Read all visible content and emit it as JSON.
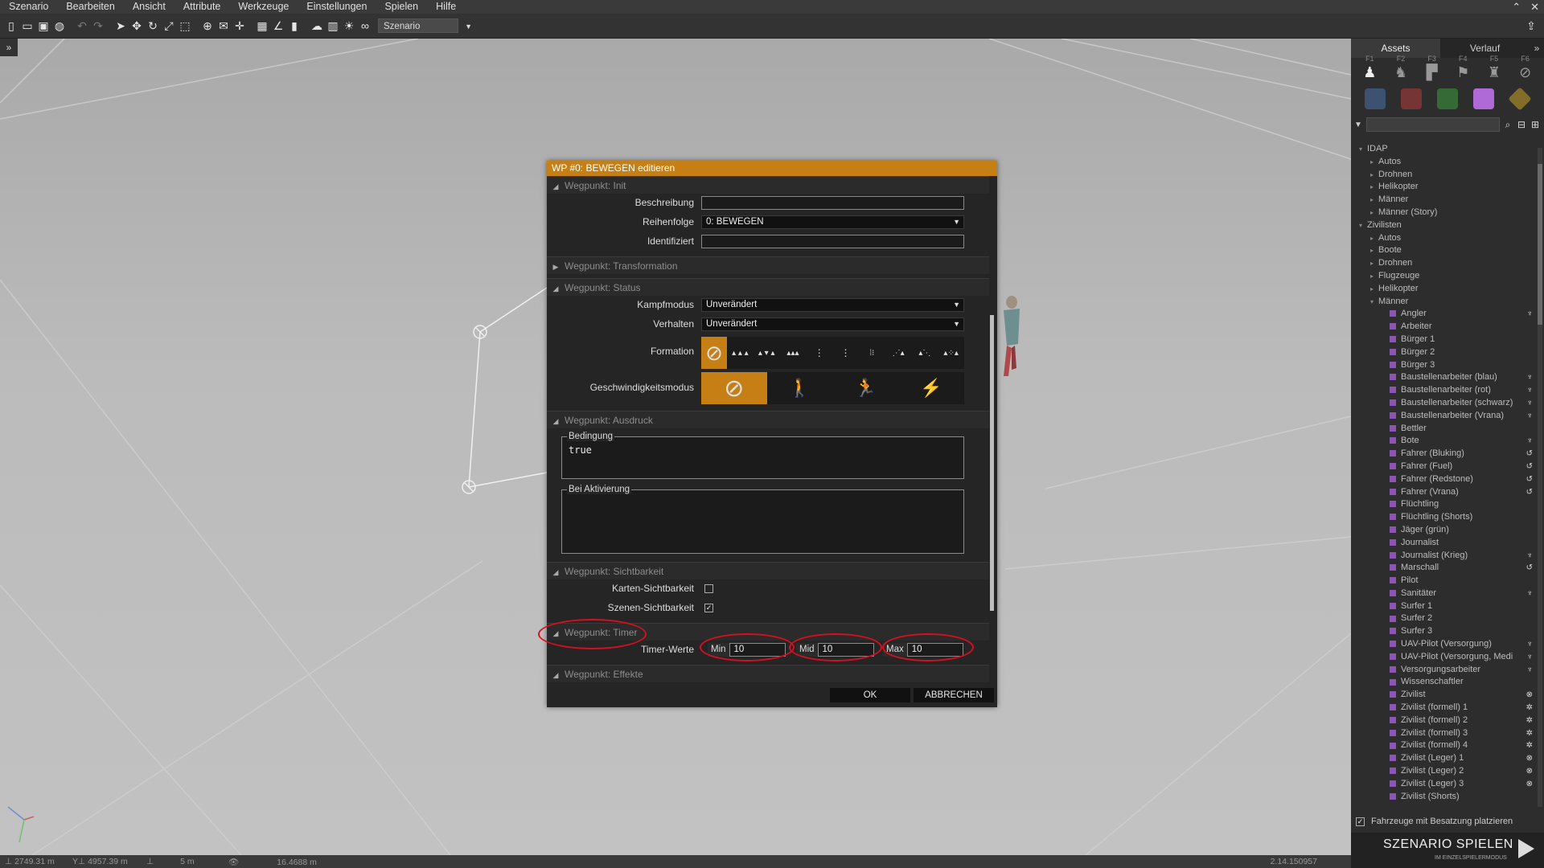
{
  "menu": {
    "items": [
      "Szenario",
      "Bearbeiten",
      "Ansicht",
      "Attribute",
      "Werkzeuge",
      "Einstellungen",
      "Spielen",
      "Hilfe"
    ]
  },
  "toolbar": {
    "scenario_select": "Szenario"
  },
  "status_bar": {
    "x": "2749.31 m",
    "y": "4957.39 m",
    "z": "5 m",
    "view": "16.4688 m",
    "right_value": "2.14.150957"
  },
  "dialog": {
    "title": "WP #0: BEWEGEN editieren",
    "sections": {
      "init": "Wegpunkt: Init",
      "transformation": "Wegpunkt: Transformation",
      "status": "Wegpunkt: Status",
      "ausdruck": "Wegpunkt: Ausdruck",
      "sichtbarkeit": "Wegpunkt: Sichtbarkeit",
      "timer": "Wegpunkt: Timer",
      "effekte": "Wegpunkt: Effekte"
    },
    "init": {
      "beschreibung_label": "Beschreibung",
      "beschreibung_value": "",
      "reihenfolge_label": "Reihenfolge",
      "reihenfolge_value": "0: BEWEGEN",
      "identifiziert_label": "Identifiziert",
      "identifiziert_value": ""
    },
    "status": {
      "kampfmodus_label": "Kampfmodus",
      "kampfmodus_value": "Unverändert",
      "verhalten_label": "Verhalten",
      "verhalten_value": "Unverändert",
      "formation_label": "Formation",
      "geschwindigkeit_label": "Geschwindigkeitsmodus"
    },
    "ausdruck": {
      "bedingung_label": "Bedingung",
      "bedingung_value": "true",
      "aktivierung_label": "Bei Aktivierung",
      "aktivierung_value": ""
    },
    "sichtbarkeit": {
      "karten_label": "Karten-Sichtbarkeit",
      "karten_checked": false,
      "szenen_label": "Szenen-Sichtbarkeit",
      "szenen_checked": true
    },
    "timer": {
      "label": "Timer-Werte",
      "min_label": "Min",
      "min_value": "10",
      "mid_label": "Mid",
      "mid_value": "10",
      "max_label": "Max",
      "max_value": "10"
    },
    "buttons": {
      "ok": "OK",
      "cancel": "ABBRECHEN"
    }
  },
  "right_panel": {
    "tabs": [
      "Assets",
      "Verlauf"
    ],
    "function_keys": [
      "F1",
      "F2",
      "F3",
      "F4",
      "F5",
      "F6"
    ],
    "swatch_colors": [
      "#4a6fa8",
      "#b33a3a",
      "#3c9a3c",
      "#b06ad8",
      "#c9a227"
    ],
    "tree": [
      {
        "label": "IDAP",
        "level": 0,
        "toggle": "▾"
      },
      {
        "label": "Autos",
        "level": 1,
        "toggle": "▸"
      },
      {
        "label": "Drohnen",
        "level": 1,
        "toggle": "▸"
      },
      {
        "label": "Helikopter",
        "level": 1,
        "toggle": "▸"
      },
      {
        "label": "Männer",
        "level": 1,
        "toggle": "▸"
      },
      {
        "label": "Männer (Story)",
        "level": 1,
        "toggle": "▸"
      },
      {
        "label": "Zivilisten",
        "level": 0,
        "toggle": "▾"
      },
      {
        "label": "Autos",
        "level": 1,
        "toggle": "▸"
      },
      {
        "label": "Boote",
        "level": 1,
        "toggle": "▸"
      },
      {
        "label": "Drohnen",
        "level": 1,
        "toggle": "▸"
      },
      {
        "label": "Flugzeuge",
        "level": 1,
        "toggle": "▸"
      },
      {
        "label": "Helikopter",
        "level": 1,
        "toggle": "▸"
      },
      {
        "label": "Männer",
        "level": 1,
        "toggle": "▾"
      },
      {
        "label": "Angler",
        "level": 2,
        "right_icon": "♆"
      },
      {
        "label": "Arbeiter",
        "level": 2
      },
      {
        "label": "Bürger 1",
        "level": 2
      },
      {
        "label": "Bürger 2",
        "level": 2
      },
      {
        "label": "Bürger 3",
        "level": 2
      },
      {
        "label": "Baustellenarbeiter (blau)",
        "level": 2,
        "right_icon": "♆"
      },
      {
        "label": "Baustellenarbeiter (rot)",
        "level": 2,
        "right_icon": "♆"
      },
      {
        "label": "Baustellenarbeiter (schwarz)",
        "level": 2,
        "right_icon": "♆"
      },
      {
        "label": "Baustellenarbeiter (Vrana)",
        "level": 2,
        "right_icon": "♆"
      },
      {
        "label": "Bettler",
        "level": 2
      },
      {
        "label": "Bote",
        "level": 2,
        "right_icon": "♆"
      },
      {
        "label": "Fahrer (Bluking)",
        "level": 2,
        "right_icon": "↺"
      },
      {
        "label": "Fahrer (Fuel)",
        "level": 2,
        "right_icon": "↺"
      },
      {
        "label": "Fahrer (Redstone)",
        "level": 2,
        "right_icon": "↺"
      },
      {
        "label": "Fahrer (Vrana)",
        "level": 2,
        "right_icon": "↺"
      },
      {
        "label": "Flüchtling",
        "level": 2
      },
      {
        "label": "Flüchtling (Shorts)",
        "level": 2
      },
      {
        "label": "Jäger (grün)",
        "level": 2
      },
      {
        "label": "Journalist",
        "level": 2
      },
      {
        "label": "Journalist (Krieg)",
        "level": 2,
        "right_icon": "♆"
      },
      {
        "label": "Marschall",
        "level": 2,
        "right_icon": "↺"
      },
      {
        "label": "Pilot",
        "level": 2
      },
      {
        "label": "Sanitäter",
        "level": 2,
        "right_icon": "♆"
      },
      {
        "label": "Surfer 1",
        "level": 2
      },
      {
        "label": "Surfer 2",
        "level": 2
      },
      {
        "label": "Surfer 3",
        "level": 2
      },
      {
        "label": "UAV-Pilot (Versorgung)",
        "level": 2,
        "right_icon": "♆"
      },
      {
        "label": "UAV-Pilot (Versorgung, Medi",
        "level": 2,
        "right_icon": "♆"
      },
      {
        "label": "Versorgungsarbeiter",
        "level": 2,
        "right_icon": "♆"
      },
      {
        "label": "Wissenschaftler",
        "level": 2
      },
      {
        "label": "Zivilist",
        "level": 2,
        "right_icon": "⊗"
      },
      {
        "label": "Zivilist (formell) 1",
        "level": 2,
        "right_icon": "✲"
      },
      {
        "label": "Zivilist (formell) 2",
        "level": 2,
        "right_icon": "✲"
      },
      {
        "label": "Zivilist (formell) 3",
        "level": 2,
        "right_icon": "✲"
      },
      {
        "label": "Zivilist (formell) 4",
        "level": 2,
        "right_icon": "✲"
      },
      {
        "label": "Zivilist (Leger) 1",
        "level": 2,
        "right_icon": "⊗"
      },
      {
        "label": "Zivilist (Leger) 2",
        "level": 2,
        "right_icon": "⊗"
      },
      {
        "label": "Zivilist (Leger) 3",
        "level": 2,
        "right_icon": "⊗"
      },
      {
        "label": "Zivilist (Shorts)",
        "level": 2
      }
    ],
    "place_with_crew_label": "Fahrzeuge mit Besatzung platzieren",
    "place_with_crew_checked": true,
    "play_button": "SZENARIO SPIELEN",
    "play_subtitle": "IM EINZELSPIELERMODUS"
  },
  "colors": {
    "accent": "#c57f14",
    "annotation": "#d80f1f"
  }
}
